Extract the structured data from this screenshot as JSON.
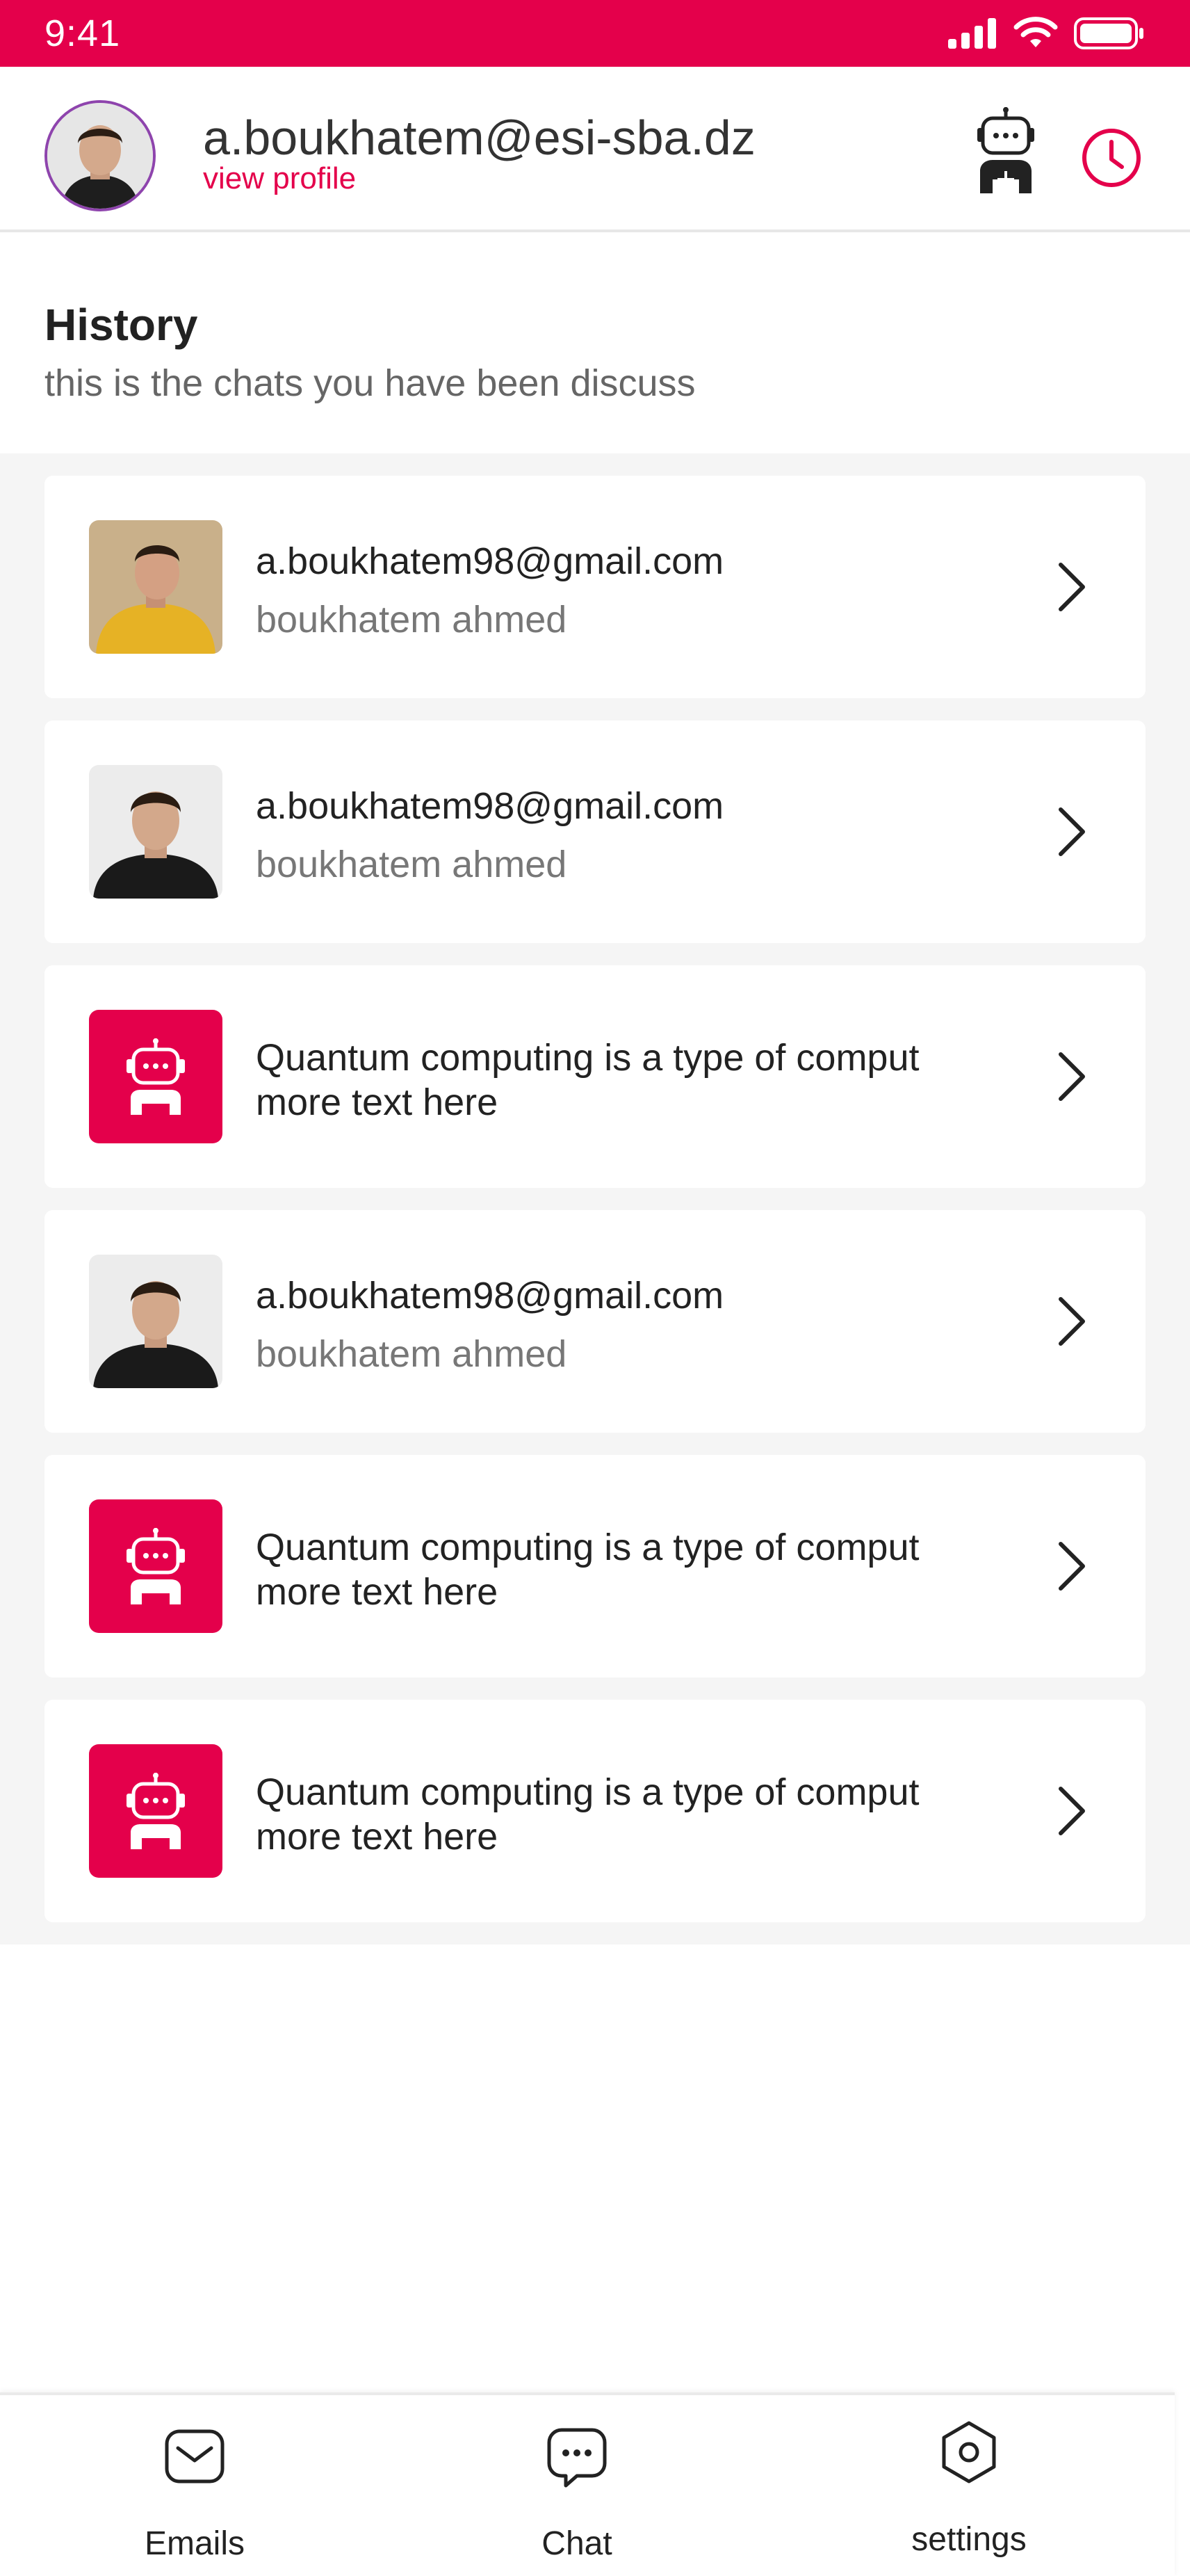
{
  "status_bar": {
    "time": "9:41",
    "icons": [
      "signal-icon",
      "wifi-icon",
      "battery-icon"
    ]
  },
  "header": {
    "email": "a.boukhatem@esi-sba.dz",
    "view_profile": "view profile",
    "actions": [
      "bot-add-icon",
      "history-icon"
    ]
  },
  "history": {
    "title": "History",
    "subtitle": "this is the chats you have been discuss"
  },
  "chats": [
    {
      "type": "user",
      "line1": "a.boukhatem98@gmail.com",
      "line2": "boukhatem ahmed"
    },
    {
      "type": "user",
      "line1": "a.boukhatem98@gmail.com",
      "line2": "boukhatem ahmed"
    },
    {
      "type": "bot",
      "line1": "Quantum computing is a type of comput",
      "line2": "more text here"
    },
    {
      "type": "user",
      "line1": "a.boukhatem98@gmail.com",
      "line2": "boukhatem ahmed"
    },
    {
      "type": "bot",
      "line1": "Quantum computing is a type of comput",
      "line2": "more text here"
    },
    {
      "type": "bot",
      "line1": "Quantum computing is a type of comput",
      "line2": "more text here"
    }
  ],
  "nav": {
    "emails": "Emails",
    "chat": "Chat",
    "settings": "settings"
  },
  "colors": {
    "accent": "#E4004B",
    "avatar_ring": "#8e44ad",
    "list_background": "#f5f5f5"
  }
}
